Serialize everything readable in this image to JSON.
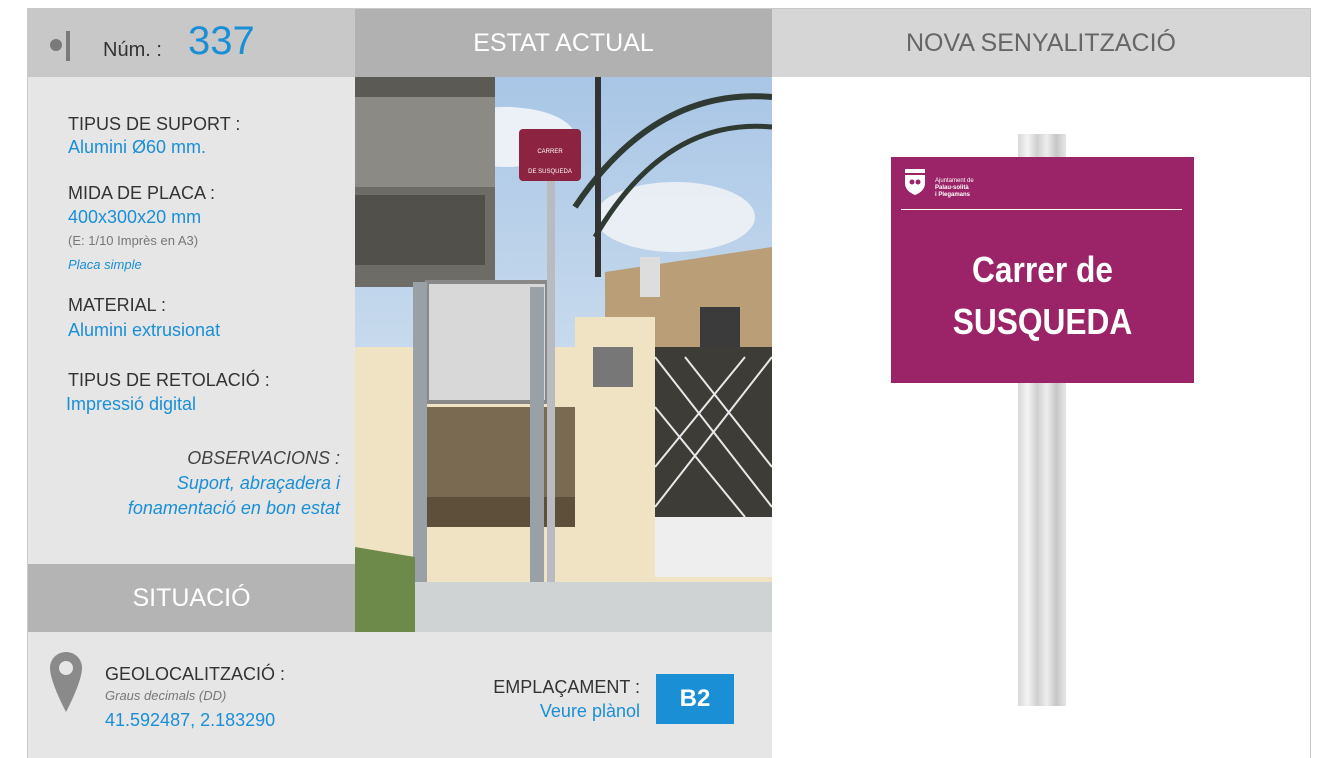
{
  "header": {
    "num_label": "Núm. :",
    "num_value": "337",
    "estat_actual": "ESTAT ACTUAL",
    "nova_senyalitzacio": "NOVA SENYALITZACIÓ"
  },
  "details": {
    "suport_label": "TIPUS DE SUPORT :",
    "suport_value": "Alumini Ø60 mm.",
    "mida_label": "MIDA DE PLACA :",
    "mida_value": "400x300x20 mm",
    "mida_scale": "(E: 1/10 Imprès en A3)",
    "mida_type": "Placa simple",
    "material_label": "MATERIAL :",
    "material_value": "Alumini extrusionat",
    "retolacio_label": "TIPUS DE RETOLACIÓ :",
    "retolacio_value": "Impressió digital",
    "observacions_label": "OBSERVACIONS :",
    "observacions_line1": "Suport, abraçadera i",
    "observacions_line2": "fonamentació en bon estat"
  },
  "situacio": {
    "title": "SITUACIÓ",
    "geo_label": "GEOLOCALITZACIÓ :",
    "geo_format": "Graus decimals (DD)",
    "geo_value": "41.592487, 2.183290",
    "emplacament_label": "EMPLAÇAMENT :",
    "emplacament_link": "Veure plànol",
    "emplacament_code": "B2"
  },
  "photo_sign": {
    "line1": "CARRER",
    "line2": "DE SUSQUEDA"
  },
  "new_sign": {
    "logo_line1": "Ajuntament de",
    "logo_line2": "Palau-solità",
    "logo_line3": "i Plegamans",
    "line1": "Carrer de",
    "line2": "SUSQUEDA"
  },
  "colors": {
    "accent_blue": "#1a8fd6",
    "sign_magenta": "#9b2468"
  }
}
